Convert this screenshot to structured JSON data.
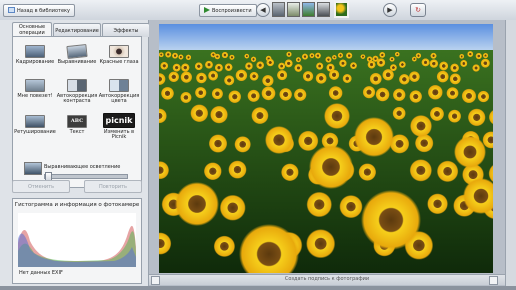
{
  "toolbar": {
    "back_label": "Назад в библиотеку",
    "slideshow_label": "Воспроизвести",
    "prev_icon": "arrow-left",
    "next_icon": "arrow-right"
  },
  "tabs": [
    {
      "label": "Основные операции",
      "active": true
    },
    {
      "label": "Редактирование",
      "active": false
    },
    {
      "label": "Эффекты",
      "active": false
    }
  ],
  "tools": [
    {
      "label": "Кадрирование",
      "icon": "crop-icon"
    },
    {
      "label": "Выравнивание",
      "icon": "straighten-icon"
    },
    {
      "label": "Красные глаза",
      "icon": "red-eye-icon"
    },
    {
      "label": "Мне повезет!",
      "icon": "lucky-icon"
    },
    {
      "label": "Автокоррекция контраста",
      "icon": "contrast-icon"
    },
    {
      "label": "Автокоррекция цвета",
      "icon": "color-icon"
    },
    {
      "label": "Ретуширование",
      "icon": "retouch-icon"
    },
    {
      "label": "Текст",
      "icon": "text-icon"
    },
    {
      "label": "Изменить в Picnik",
      "icon": "picnik-icon"
    }
  ],
  "picnik_logo": "picnik",
  "text_icon_glyph": "ABC",
  "fill_light": {
    "label": "Выравнивающее осветление",
    "value": 0.0
  },
  "undo_label": "Отменить",
  "redo_label": "Повторить",
  "histogram": {
    "title": "Гистограмма и информация о фотокамере",
    "exif": "Нет данных EXIF"
  },
  "caption_placeholder": "Создать подпись к фотографии",
  "colors": {
    "accent": "#2a6fc9",
    "panel": "#f4f5f6"
  }
}
